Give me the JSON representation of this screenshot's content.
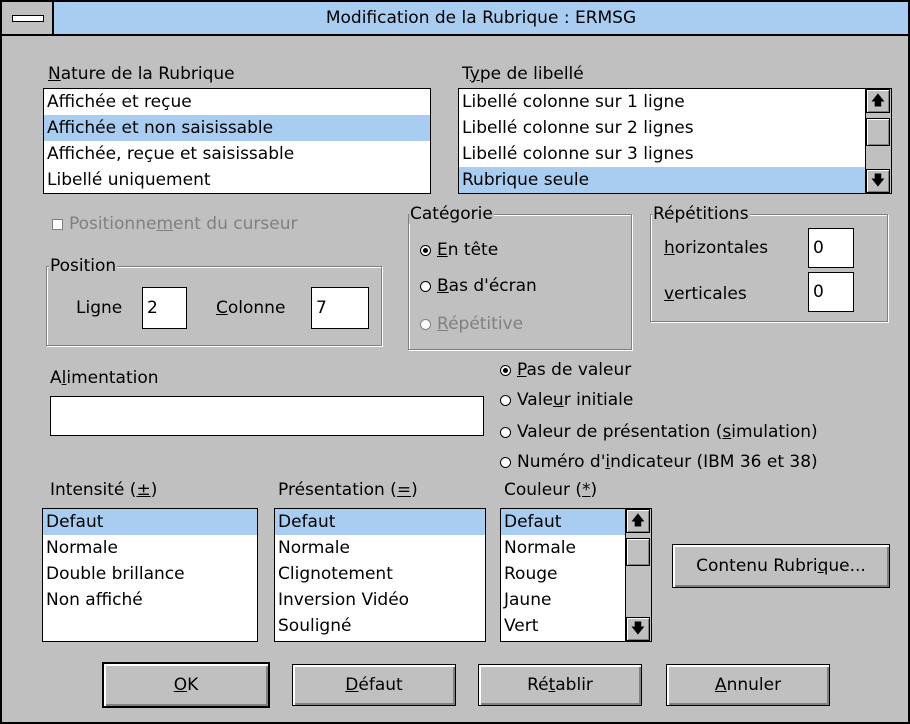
{
  "window": {
    "title": "Modification de la Rubrique : ERMSG"
  },
  "nature": {
    "label_pre": "",
    "label_key": "N",
    "label_post": "ature de la Rubrique",
    "items": [
      "Affichée et reçue",
      "Affichée et non saisissable",
      "Affichée, reçue et saisissable",
      "Libellé uniquement"
    ],
    "selected_index": 1
  },
  "type_libelle": {
    "label_pre": "T",
    "label_key": "y",
    "label_post": "pe de libellé",
    "items": [
      "Libellé colonne sur 1 ligne",
      "Libellé colonne sur 2 lignes",
      "Libellé colonne sur 3 lignes",
      "Rubrique seule"
    ],
    "selected_index": 3
  },
  "positionnement": {
    "pre": "Positionne",
    "key": "m",
    "post": "ent du curseur",
    "checked": false
  },
  "position": {
    "legend": "Position",
    "ligne_label": "Ligne",
    "ligne_value": "2",
    "colonne_pre": "",
    "colonne_key": "C",
    "colonne_post": "olonne",
    "colonne_value": "7"
  },
  "categorie": {
    "legend": "Catégorie",
    "options": [
      {
        "pre": "",
        "key": "E",
        "post": "n tête",
        "selected": true,
        "disabled": false
      },
      {
        "pre": "",
        "key": "B",
        "post": "as d'écran",
        "selected": false,
        "disabled": false
      },
      {
        "pre": "",
        "key": "R",
        "post": "épétitive",
        "selected": false,
        "disabled": true
      }
    ]
  },
  "repetitions": {
    "legend": "Répétitions",
    "horizontales_pre": "",
    "horizontales_key": "h",
    "horizontales_post": "orizontales",
    "horizontales_value": "0",
    "verticales_pre": "",
    "verticales_key": "v",
    "verticales_post": "erticales",
    "verticales_value": "0"
  },
  "alimentation": {
    "label_pre": "A",
    "label_key": "l",
    "label_post": "imentation",
    "value": "",
    "options": [
      {
        "pre": "",
        "key": "P",
        "post": "as de valeur",
        "selected": true
      },
      {
        "pre": "Vale",
        "key": "u",
        "post": "r initiale",
        "selected": false
      },
      {
        "pre": "Valeur de présentation (",
        "key": "s",
        "post": "imulation)",
        "selected": false
      },
      {
        "pre": "Numéro d'",
        "key": "i",
        "post": "ndicateur (IBM 36 et 38)",
        "selected": false
      }
    ]
  },
  "intensite": {
    "label_pre": "Intensité (",
    "label_key": "±",
    "label_post": ")",
    "items": [
      "Defaut",
      "Normale",
      "Double brillance",
      "Non affiché"
    ],
    "selected_index": 0
  },
  "presentation": {
    "label_pre": "Présentation (",
    "label_key": "=",
    "label_post": ")",
    "items": [
      "Defaut",
      "Normale",
      "Clignotement",
      "Inversion Vidéo",
      "Souligné"
    ],
    "selected_index": 0
  },
  "couleur": {
    "label_pre": "Couleur (",
    "label_key": "*",
    "label_post": ")",
    "items": [
      "Defaut",
      "Normale",
      "Rouge",
      "Jaune",
      "Vert"
    ],
    "selected_index": 0
  },
  "buttons": {
    "contenu_pre": "Contenu Rubri",
    "contenu_key": "q",
    "contenu_post": "ue...",
    "ok_pre": "",
    "ok_key": "O",
    "ok_post": "K",
    "defaut_pre": "",
    "defaut_key": "D",
    "defaut_post": "éfaut",
    "retablir_pre": "Ré",
    "retablir_key": "t",
    "retablir_post": "ablir",
    "annuler_pre": "",
    "annuler_key": "A",
    "annuler_post": "nnuler"
  },
  "icons": {
    "scroll_up": "▲-arrow-up-icon",
    "scroll_down": "arrow-down-icon"
  },
  "colors": {
    "selection": "#a8cdf0",
    "title_bar": "#a8cdf0",
    "face": "#c0c0c0"
  }
}
